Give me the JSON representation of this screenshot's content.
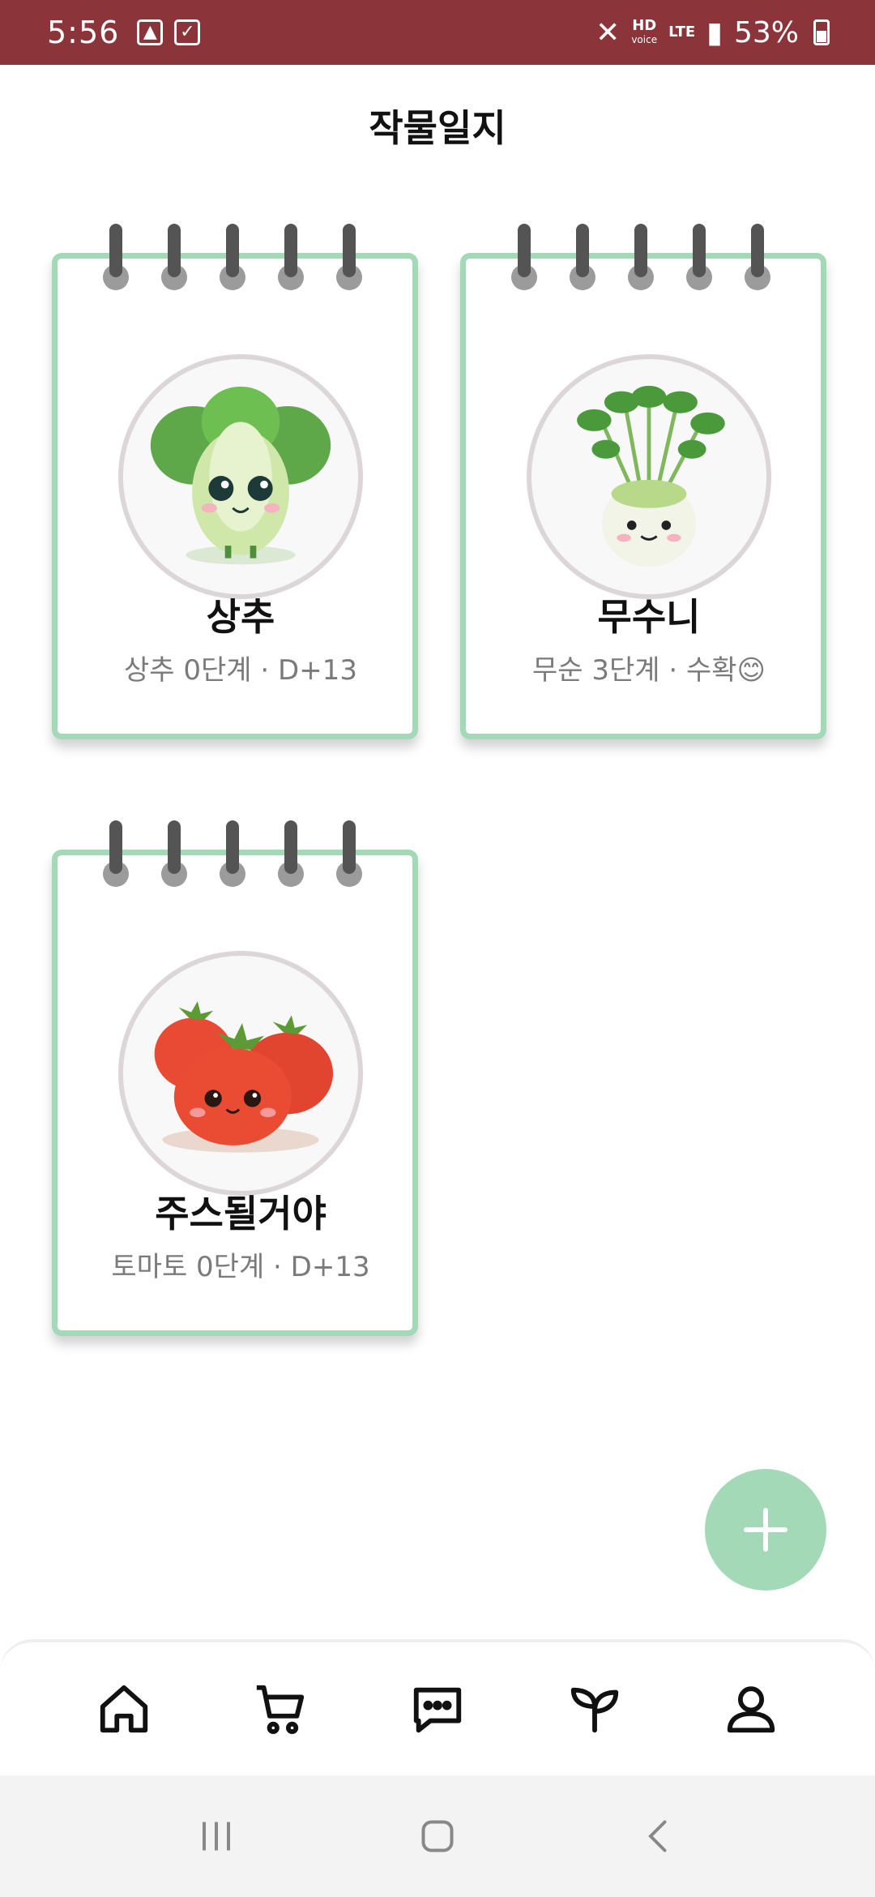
{
  "status_bar": {
    "time": "5:56",
    "network": "LTE",
    "battery": "53%",
    "hd_label": "HD",
    "voice_label": "voice"
  },
  "page": {
    "title": "작물일지"
  },
  "crops": [
    {
      "name": "상추",
      "subtitle": "상추 0단계 · D+13",
      "icon": "lettuce-illustration"
    },
    {
      "name": "무수니",
      "subtitle": "무순 3단계 · 수확😊",
      "icon": "radish-sprout-illustration"
    },
    {
      "name": "주스될거야",
      "subtitle": "토마토 0단계 · D+13",
      "icon": "tomato-illustration"
    }
  ],
  "fab": {
    "icon": "plus-icon"
  },
  "bottom_nav": [
    "home-icon",
    "cart-icon",
    "chat-icon",
    "sprout-icon",
    "profile-icon"
  ],
  "system_nav": [
    "recents-icon",
    "home-circle-icon",
    "back-icon"
  ],
  "colors": {
    "status_bar": "#8b353b",
    "accent_green": "#a3d9b6",
    "ring": "#545454"
  }
}
